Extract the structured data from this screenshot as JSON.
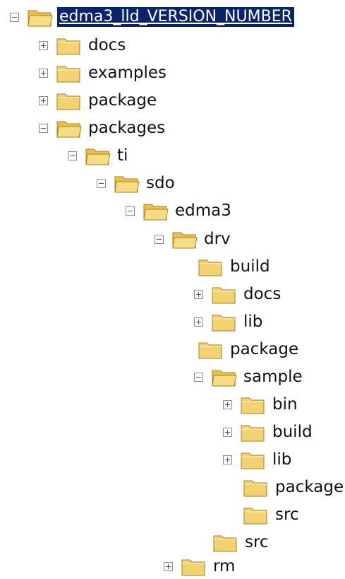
{
  "tree": {
    "nodes": [
      {
        "label": "edma3_lld_VERSION_NUMBER",
        "state": "expanded",
        "selected": true
      },
      {
        "label": "docs",
        "state": "collapsed"
      },
      {
        "label": "examples",
        "state": "collapsed"
      },
      {
        "label": "package",
        "state": "collapsed"
      },
      {
        "label": "packages",
        "state": "expanded"
      },
      {
        "label": "ti",
        "state": "expanded"
      },
      {
        "label": "sdo",
        "state": "expanded"
      },
      {
        "label": "edma3",
        "state": "expanded"
      },
      {
        "label": "drv",
        "state": "expanded"
      },
      {
        "label": "build",
        "state": "leaf"
      },
      {
        "label": "docs",
        "state": "collapsed"
      },
      {
        "label": "lib",
        "state": "collapsed"
      },
      {
        "label": "package",
        "state": "leaf"
      },
      {
        "label": "sample",
        "state": "expanded"
      },
      {
        "label": "bin",
        "state": "collapsed"
      },
      {
        "label": "build",
        "state": "collapsed"
      },
      {
        "label": "lib",
        "state": "collapsed"
      },
      {
        "label": "package",
        "state": "leaf"
      },
      {
        "label": "src",
        "state": "leaf"
      },
      {
        "label": "src",
        "state": "leaf"
      },
      {
        "label": "rm",
        "state": "collapsed"
      }
    ]
  },
  "colors": {
    "selection": "#0a246a",
    "folder": "#f5d77a"
  },
  "icons": {
    "folder": "folder-icon",
    "expand": "plus-icon",
    "collapse": "minus-icon"
  }
}
